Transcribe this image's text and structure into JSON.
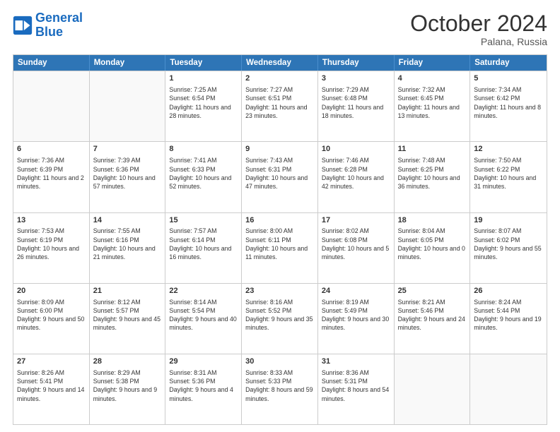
{
  "logo": {
    "line1": "General",
    "line2": "Blue"
  },
  "title": "October 2024",
  "location": "Palana, Russia",
  "days": [
    "Sunday",
    "Monday",
    "Tuesday",
    "Wednesday",
    "Thursday",
    "Friday",
    "Saturday"
  ],
  "weeks": [
    [
      {
        "day": "",
        "empty": true
      },
      {
        "day": "",
        "empty": true
      },
      {
        "day": "1",
        "sunrise": "Sunrise: 7:25 AM",
        "sunset": "Sunset: 6:54 PM",
        "daylight": "Daylight: 11 hours and 28 minutes."
      },
      {
        "day": "2",
        "sunrise": "Sunrise: 7:27 AM",
        "sunset": "Sunset: 6:51 PM",
        "daylight": "Daylight: 11 hours and 23 minutes."
      },
      {
        "day": "3",
        "sunrise": "Sunrise: 7:29 AM",
        "sunset": "Sunset: 6:48 PM",
        "daylight": "Daylight: 11 hours and 18 minutes."
      },
      {
        "day": "4",
        "sunrise": "Sunrise: 7:32 AM",
        "sunset": "Sunset: 6:45 PM",
        "daylight": "Daylight: 11 hours and 13 minutes."
      },
      {
        "day": "5",
        "sunrise": "Sunrise: 7:34 AM",
        "sunset": "Sunset: 6:42 PM",
        "daylight": "Daylight: 11 hours and 8 minutes."
      }
    ],
    [
      {
        "day": "6",
        "sunrise": "Sunrise: 7:36 AM",
        "sunset": "Sunset: 6:39 PM",
        "daylight": "Daylight: 11 hours and 2 minutes."
      },
      {
        "day": "7",
        "sunrise": "Sunrise: 7:39 AM",
        "sunset": "Sunset: 6:36 PM",
        "daylight": "Daylight: 10 hours and 57 minutes."
      },
      {
        "day": "8",
        "sunrise": "Sunrise: 7:41 AM",
        "sunset": "Sunset: 6:33 PM",
        "daylight": "Daylight: 10 hours and 52 minutes."
      },
      {
        "day": "9",
        "sunrise": "Sunrise: 7:43 AM",
        "sunset": "Sunset: 6:31 PM",
        "daylight": "Daylight: 10 hours and 47 minutes."
      },
      {
        "day": "10",
        "sunrise": "Sunrise: 7:46 AM",
        "sunset": "Sunset: 6:28 PM",
        "daylight": "Daylight: 10 hours and 42 minutes."
      },
      {
        "day": "11",
        "sunrise": "Sunrise: 7:48 AM",
        "sunset": "Sunset: 6:25 PM",
        "daylight": "Daylight: 10 hours and 36 minutes."
      },
      {
        "day": "12",
        "sunrise": "Sunrise: 7:50 AM",
        "sunset": "Sunset: 6:22 PM",
        "daylight": "Daylight: 10 hours and 31 minutes."
      }
    ],
    [
      {
        "day": "13",
        "sunrise": "Sunrise: 7:53 AM",
        "sunset": "Sunset: 6:19 PM",
        "daylight": "Daylight: 10 hours and 26 minutes."
      },
      {
        "day": "14",
        "sunrise": "Sunrise: 7:55 AM",
        "sunset": "Sunset: 6:16 PM",
        "daylight": "Daylight: 10 hours and 21 minutes."
      },
      {
        "day": "15",
        "sunrise": "Sunrise: 7:57 AM",
        "sunset": "Sunset: 6:14 PM",
        "daylight": "Daylight: 10 hours and 16 minutes."
      },
      {
        "day": "16",
        "sunrise": "Sunrise: 8:00 AM",
        "sunset": "Sunset: 6:11 PM",
        "daylight": "Daylight: 10 hours and 11 minutes."
      },
      {
        "day": "17",
        "sunrise": "Sunrise: 8:02 AM",
        "sunset": "Sunset: 6:08 PM",
        "daylight": "Daylight: 10 hours and 5 minutes."
      },
      {
        "day": "18",
        "sunrise": "Sunrise: 8:04 AM",
        "sunset": "Sunset: 6:05 PM",
        "daylight": "Daylight: 10 hours and 0 minutes."
      },
      {
        "day": "19",
        "sunrise": "Sunrise: 8:07 AM",
        "sunset": "Sunset: 6:02 PM",
        "daylight": "Daylight: 9 hours and 55 minutes."
      }
    ],
    [
      {
        "day": "20",
        "sunrise": "Sunrise: 8:09 AM",
        "sunset": "Sunset: 6:00 PM",
        "daylight": "Daylight: 9 hours and 50 minutes."
      },
      {
        "day": "21",
        "sunrise": "Sunrise: 8:12 AM",
        "sunset": "Sunset: 5:57 PM",
        "daylight": "Daylight: 9 hours and 45 minutes."
      },
      {
        "day": "22",
        "sunrise": "Sunrise: 8:14 AM",
        "sunset": "Sunset: 5:54 PM",
        "daylight": "Daylight: 9 hours and 40 minutes."
      },
      {
        "day": "23",
        "sunrise": "Sunrise: 8:16 AM",
        "sunset": "Sunset: 5:52 PM",
        "daylight": "Daylight: 9 hours and 35 minutes."
      },
      {
        "day": "24",
        "sunrise": "Sunrise: 8:19 AM",
        "sunset": "Sunset: 5:49 PM",
        "daylight": "Daylight: 9 hours and 30 minutes."
      },
      {
        "day": "25",
        "sunrise": "Sunrise: 8:21 AM",
        "sunset": "Sunset: 5:46 PM",
        "daylight": "Daylight: 9 hours and 24 minutes."
      },
      {
        "day": "26",
        "sunrise": "Sunrise: 8:24 AM",
        "sunset": "Sunset: 5:44 PM",
        "daylight": "Daylight: 9 hours and 19 minutes."
      }
    ],
    [
      {
        "day": "27",
        "sunrise": "Sunrise: 8:26 AM",
        "sunset": "Sunset: 5:41 PM",
        "daylight": "Daylight: 9 hours and 14 minutes."
      },
      {
        "day": "28",
        "sunrise": "Sunrise: 8:29 AM",
        "sunset": "Sunset: 5:38 PM",
        "daylight": "Daylight: 9 hours and 9 minutes."
      },
      {
        "day": "29",
        "sunrise": "Sunrise: 8:31 AM",
        "sunset": "Sunset: 5:36 PM",
        "daylight": "Daylight: 9 hours and 4 minutes."
      },
      {
        "day": "30",
        "sunrise": "Sunrise: 8:33 AM",
        "sunset": "Sunset: 5:33 PM",
        "daylight": "Daylight: 8 hours and 59 minutes."
      },
      {
        "day": "31",
        "sunrise": "Sunrise: 8:36 AM",
        "sunset": "Sunset: 5:31 PM",
        "daylight": "Daylight: 8 hours and 54 minutes."
      },
      {
        "day": "",
        "empty": true
      },
      {
        "day": "",
        "empty": true
      }
    ]
  ]
}
